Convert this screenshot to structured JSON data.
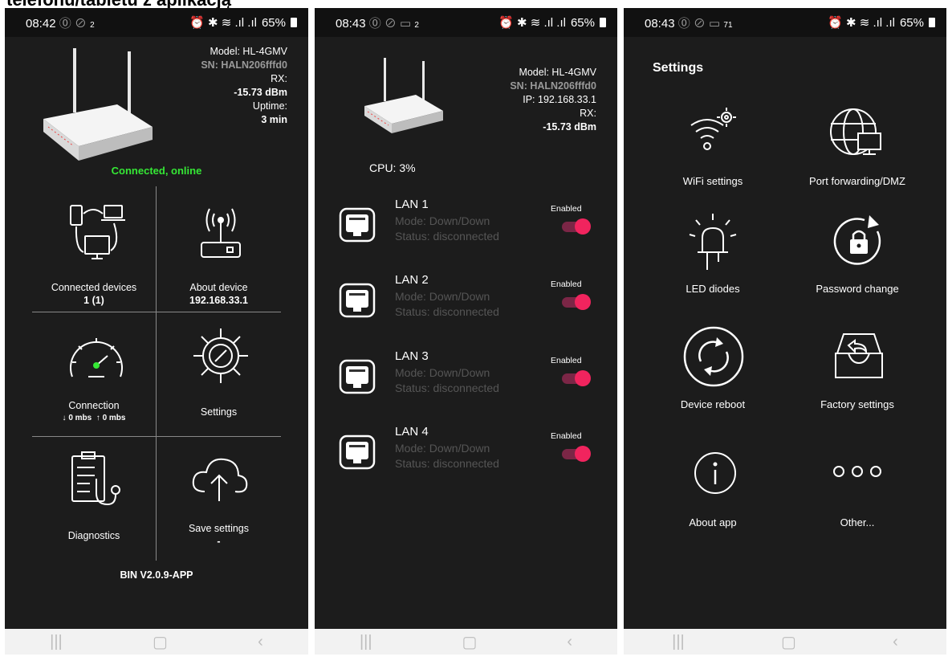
{
  "caption": "telefonu/tabletu z aplikacją",
  "screen1": {
    "status": {
      "time": "08:42",
      "net": "2",
      "pct": "65%"
    },
    "model": "Model: HL-4GMV",
    "sn": "SN: HALN206fffd0",
    "rx_label": "RX:",
    "rx_value": "-15.73 dBm",
    "uptime_label": "Uptime:",
    "uptime_value": "3 min",
    "connection_status": "Connected, online",
    "tiles": {
      "connected_devices": {
        "label": "Connected devices",
        "value": "1 (1)"
      },
      "about_device": {
        "label": "About device",
        "value": "192.168.33.1"
      },
      "connection": {
        "label": "Connection",
        "down": "0 mbs",
        "up": "0 mbs"
      },
      "settings": {
        "label": "Settings"
      },
      "diagnostics": {
        "label": "Diagnostics"
      },
      "save_settings": {
        "label": "Save settings",
        "value": "-"
      }
    },
    "version": "BIN V2.0.9-APP"
  },
  "screen2": {
    "status": {
      "time": "08:43",
      "net": "2",
      "pct": "65%"
    },
    "model": "Model: HL-4GMV",
    "sn": "SN: HALN206fffd0",
    "ip": "IP: 192.168.33.1",
    "rx_label": "RX:",
    "rx_value": "-15.73 dBm",
    "cpu": "CPU: 3%",
    "lans": [
      {
        "name": "LAN 1",
        "mode": "Mode: Down/Down",
        "status": "Status: disconnected",
        "toggle_label": "Enabled",
        "enabled": true
      },
      {
        "name": "LAN 2",
        "mode": "Mode: Down/Down",
        "status": "Status: disconnected",
        "toggle_label": "Enabled",
        "enabled": true
      },
      {
        "name": "LAN 3",
        "mode": "Mode: Down/Down",
        "status": "Status: disconnected",
        "toggle_label": "Enabled",
        "enabled": true
      },
      {
        "name": "LAN 4",
        "mode": "Mode: Down/Down",
        "status": "Status: disconnected",
        "toggle_label": "Enabled",
        "enabled": true
      }
    ]
  },
  "screen3": {
    "status": {
      "time": "08:43",
      "net": "71",
      "pct": "65%"
    },
    "title": "Settings",
    "items": [
      {
        "label": "WiFi settings",
        "icon": "wifi-gear-icon"
      },
      {
        "label": "Port forwarding/DMZ",
        "icon": "globe-monitor-icon"
      },
      {
        "label": "LED diodes",
        "icon": "led-icon"
      },
      {
        "label": "Password change",
        "icon": "lock-refresh-icon"
      },
      {
        "label": "Device reboot",
        "icon": "reboot-icon"
      },
      {
        "label": "Factory settings",
        "icon": "tray-restore-icon"
      },
      {
        "label": "About app",
        "icon": "info-icon"
      },
      {
        "label": "Other...",
        "icon": "more-icon"
      }
    ]
  },
  "colors": {
    "background": "#1c1c1c",
    "online": "#35e835",
    "toggle_knob": "#f1245e",
    "toggle_track": "#7b2646"
  }
}
